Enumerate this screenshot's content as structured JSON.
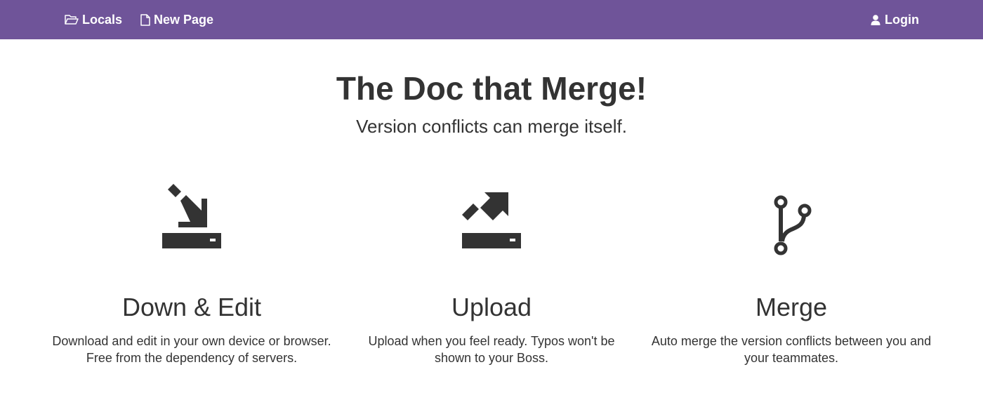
{
  "nav": {
    "locals_label": "Locals",
    "new_page_label": "New Page",
    "login_label": "Login"
  },
  "hero": {
    "title": "The Doc that Merge!",
    "subtitle": "Version conflicts can merge itself."
  },
  "features": [
    {
      "title": "Down & Edit",
      "line1": "Download and edit in your own device or browser.",
      "line2": "Free from the dependency of servers.",
      "icon": "download-icon"
    },
    {
      "title": "Upload",
      "line1": "Upload when you feel ready. Typos won't be",
      "line2": "shown to your Boss.",
      "icon": "upload-icon"
    },
    {
      "title": "Merge",
      "line1": "Auto merge the version conflicts between you and",
      "line2": "your teammates.",
      "icon": "merge-branch-icon"
    }
  ],
  "colors": {
    "navbar": "#6f5499",
    "text": "#333333",
    "icon": "#333333"
  }
}
